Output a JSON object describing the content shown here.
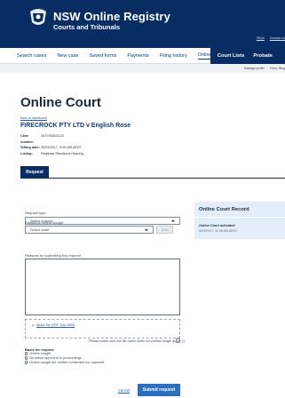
{
  "brand": {
    "title": "NSW Online Registry",
    "subtitle": "Courts and Tribunals"
  },
  "utility_links": [
    "FAQs",
    "Contact us"
  ],
  "nav": {
    "items": [
      "Search cases",
      "New case",
      "Saved forms",
      "Payments",
      "Filing history",
      "Online Court"
    ],
    "active": "Online Court",
    "dark_items": [
      "Court Lists",
      "Probate"
    ]
  },
  "subbar_links": [
    "Manage profile",
    "Fees, filing"
  ],
  "page": {
    "title": "Online Court",
    "back_link": "Back to dashboard",
    "case_name": "FIRECROCK PTY LTD v English Rose",
    "meta": [
      {
        "key": "Case number:",
        "value": "2017/00011122"
      },
      {
        "key": "Sitting date:",
        "value": "20/03/2017, 9:00 AM AEDT"
      },
      {
        "key": "Listing:",
        "value": "Registrar Directions Hearing"
      }
    ]
  },
  "tabs": {
    "request": "Request"
  },
  "form": {
    "request_type_label": "Request type",
    "request_type_value": "Select request",
    "additional_orders_label": "Additional orders sought",
    "additional_orders_value": "Select order",
    "add_label": "Add",
    "reasons_label": "Reasons for submitting this request",
    "attach_label": "Attach file (PDF, max 5MB)",
    "note": "Please make sure the file name does not contain single quote (')",
    "basis_title": "Basis for request",
    "basis_options": [
      "Orders sought",
      "No active opponent in proceedings",
      "Orders sought are neither consented nor opposed"
    ],
    "cancel_label": "Cancel",
    "submit_label": "Submit request"
  },
  "panel": {
    "title": "Online Court Record",
    "event": "Online Court activated",
    "timestamp": "8/03/2017, 11:48 AM AEDT"
  },
  "colors": {
    "header_bg": "#082d63",
    "accent": "#2d6fbf",
    "panel_bg": "#e3eef8"
  }
}
